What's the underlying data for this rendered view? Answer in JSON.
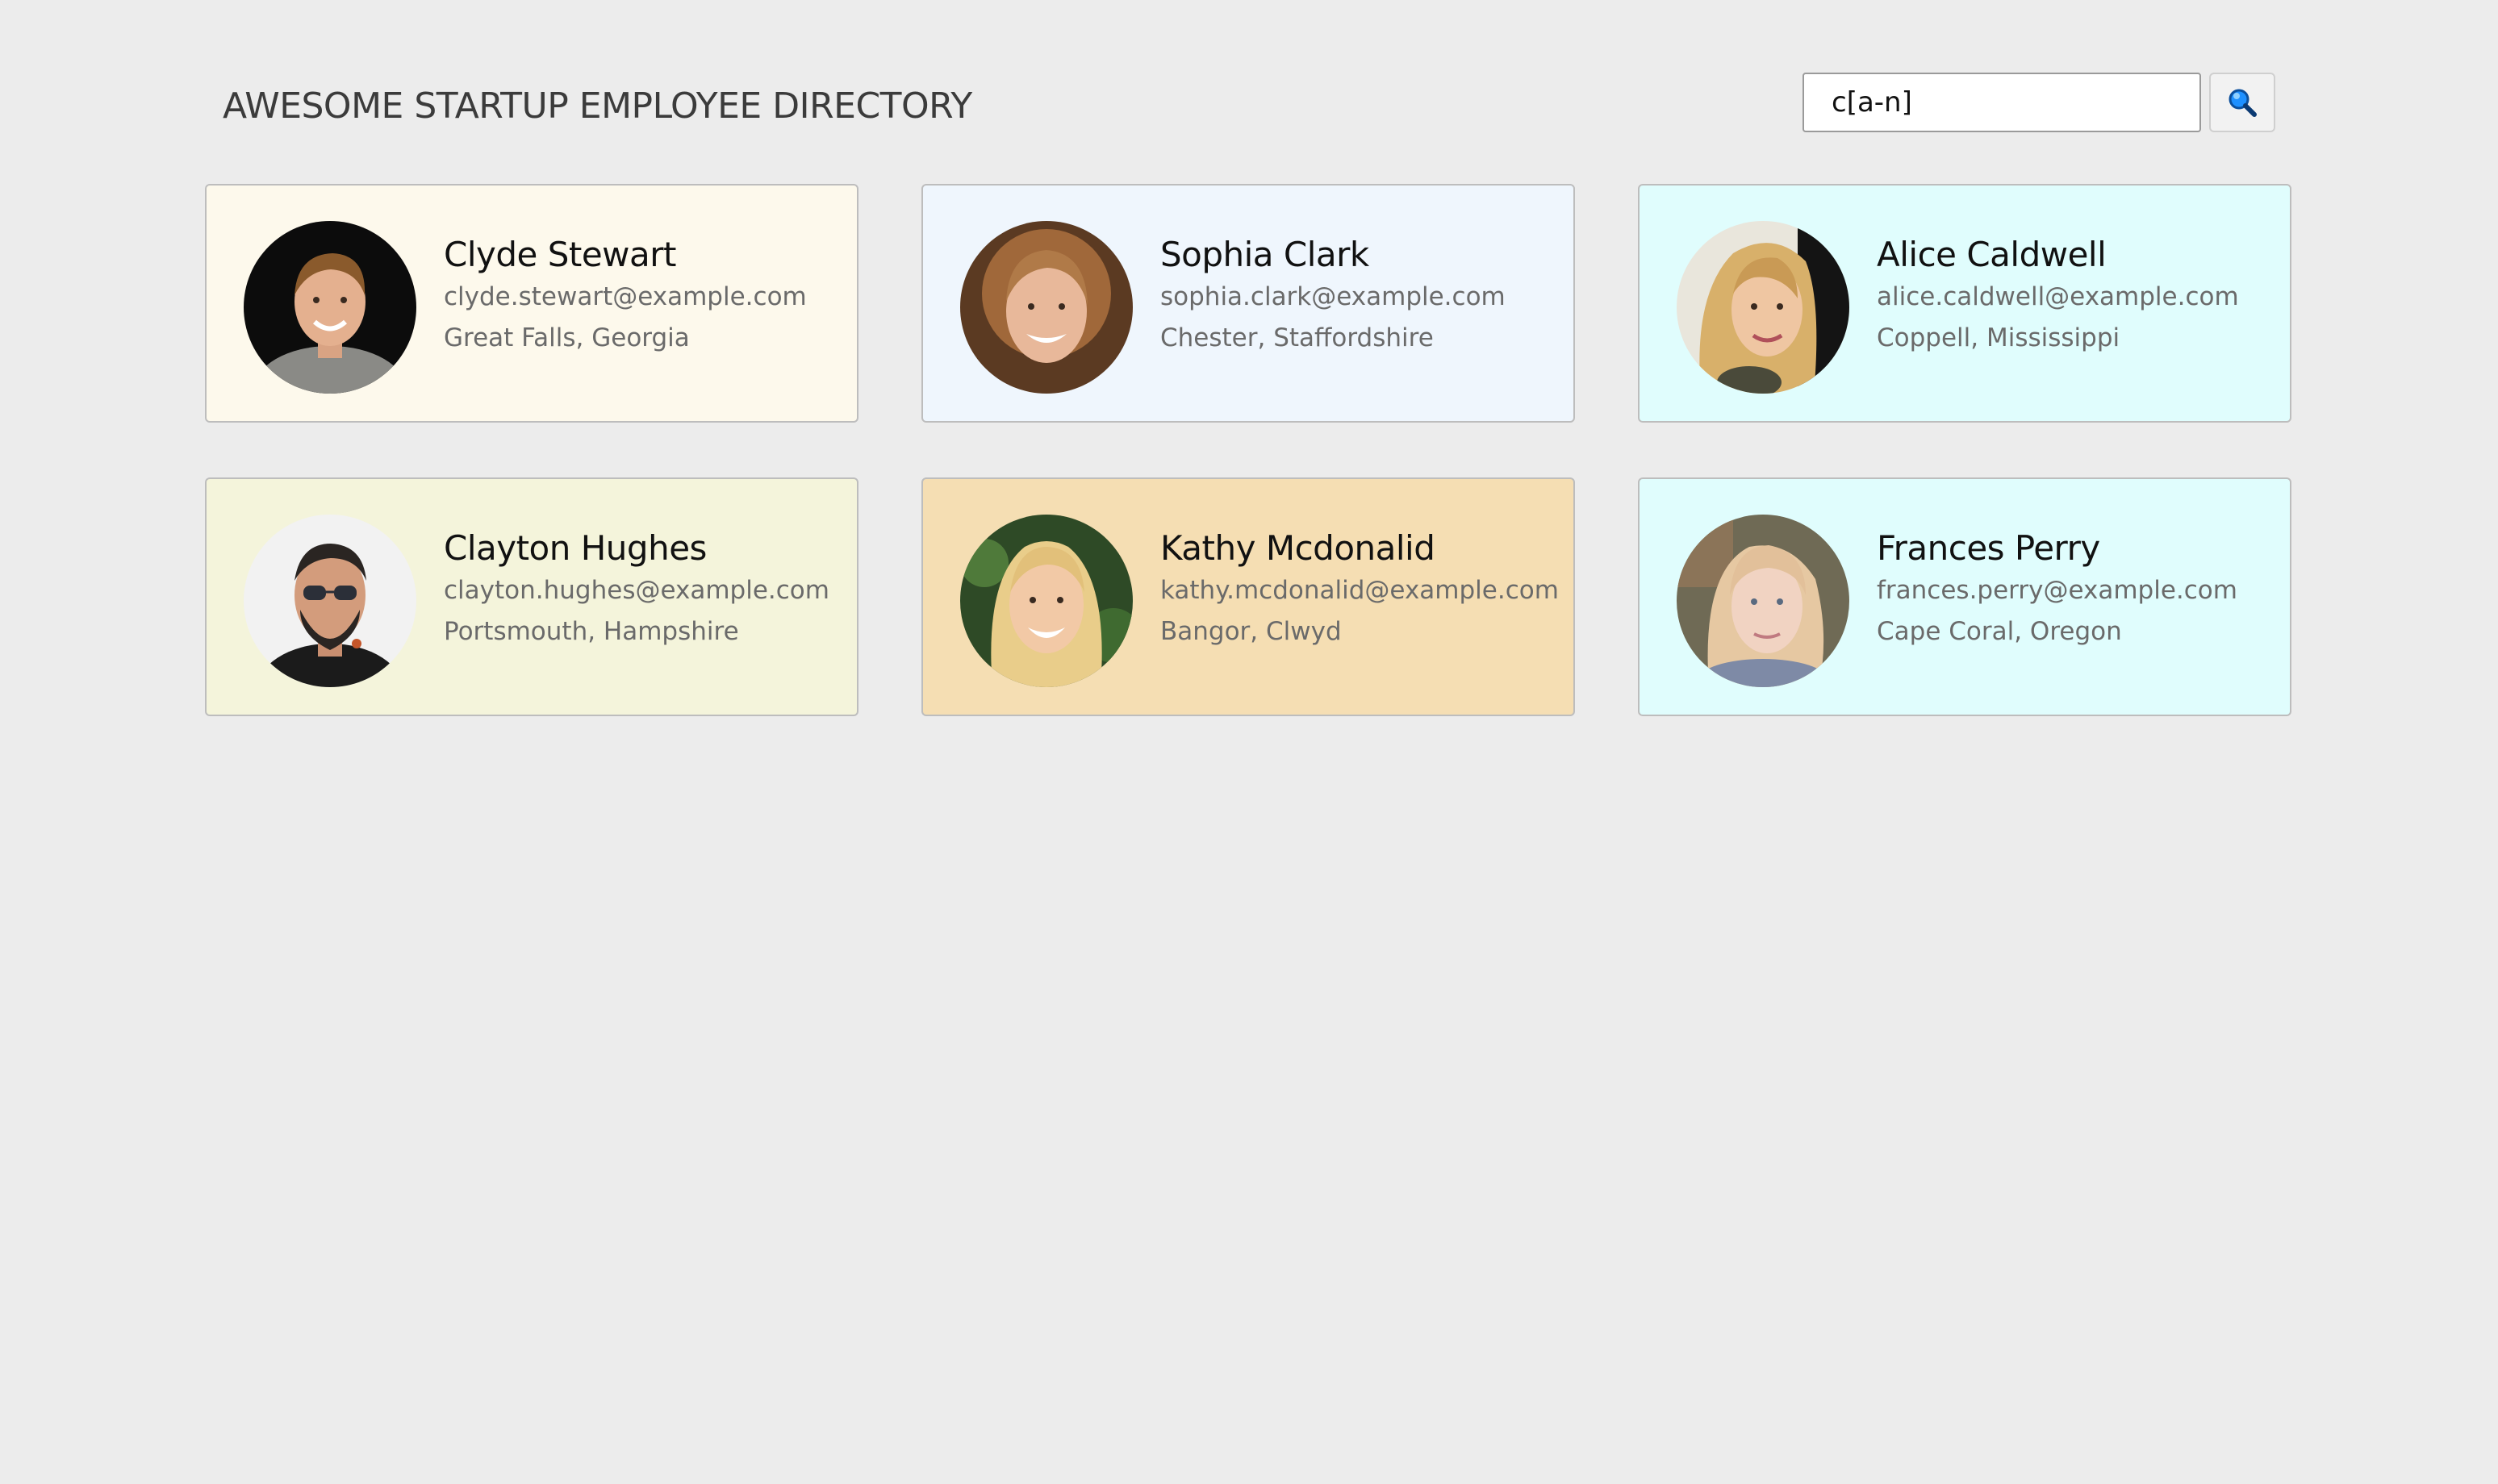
{
  "header": {
    "title": "AWESOME STARTUP EMPLOYEE DIRECTORY"
  },
  "search": {
    "value": "c[a-n]",
    "button_icon": "magnifier-icon"
  },
  "employees": [
    {
      "name": "Clyde Stewart",
      "email": "clyde.stewart@example.com",
      "location": "Great Falls, Georgia",
      "card_color": "#fdf9ec"
    },
    {
      "name": "Sophia Clark",
      "email": "sophia.clark@example.com",
      "location": "Chester, Staffordshire",
      "card_color": "#eff6fd"
    },
    {
      "name": "Alice Caldwell",
      "email": "alice.caldwell@example.com",
      "location": "Coppell, Mississippi",
      "card_color": "#e0fdfd"
    },
    {
      "name": "Clayton Hughes",
      "email": "clayton.hughes@example.com",
      "location": "Portsmouth, Hampshire",
      "card_color": "#f4f4db"
    },
    {
      "name": "Kathy Mcdonalid",
      "email": "kathy.mcdonalid@example.com",
      "location": "Bangor, Clwyd",
      "card_color": "#f5deb3"
    },
    {
      "name": "Frances Perry",
      "email": "frances.perry@example.com",
      "location": "Cape Coral, Oregon",
      "card_color": "#e0fdfd"
    }
  ]
}
